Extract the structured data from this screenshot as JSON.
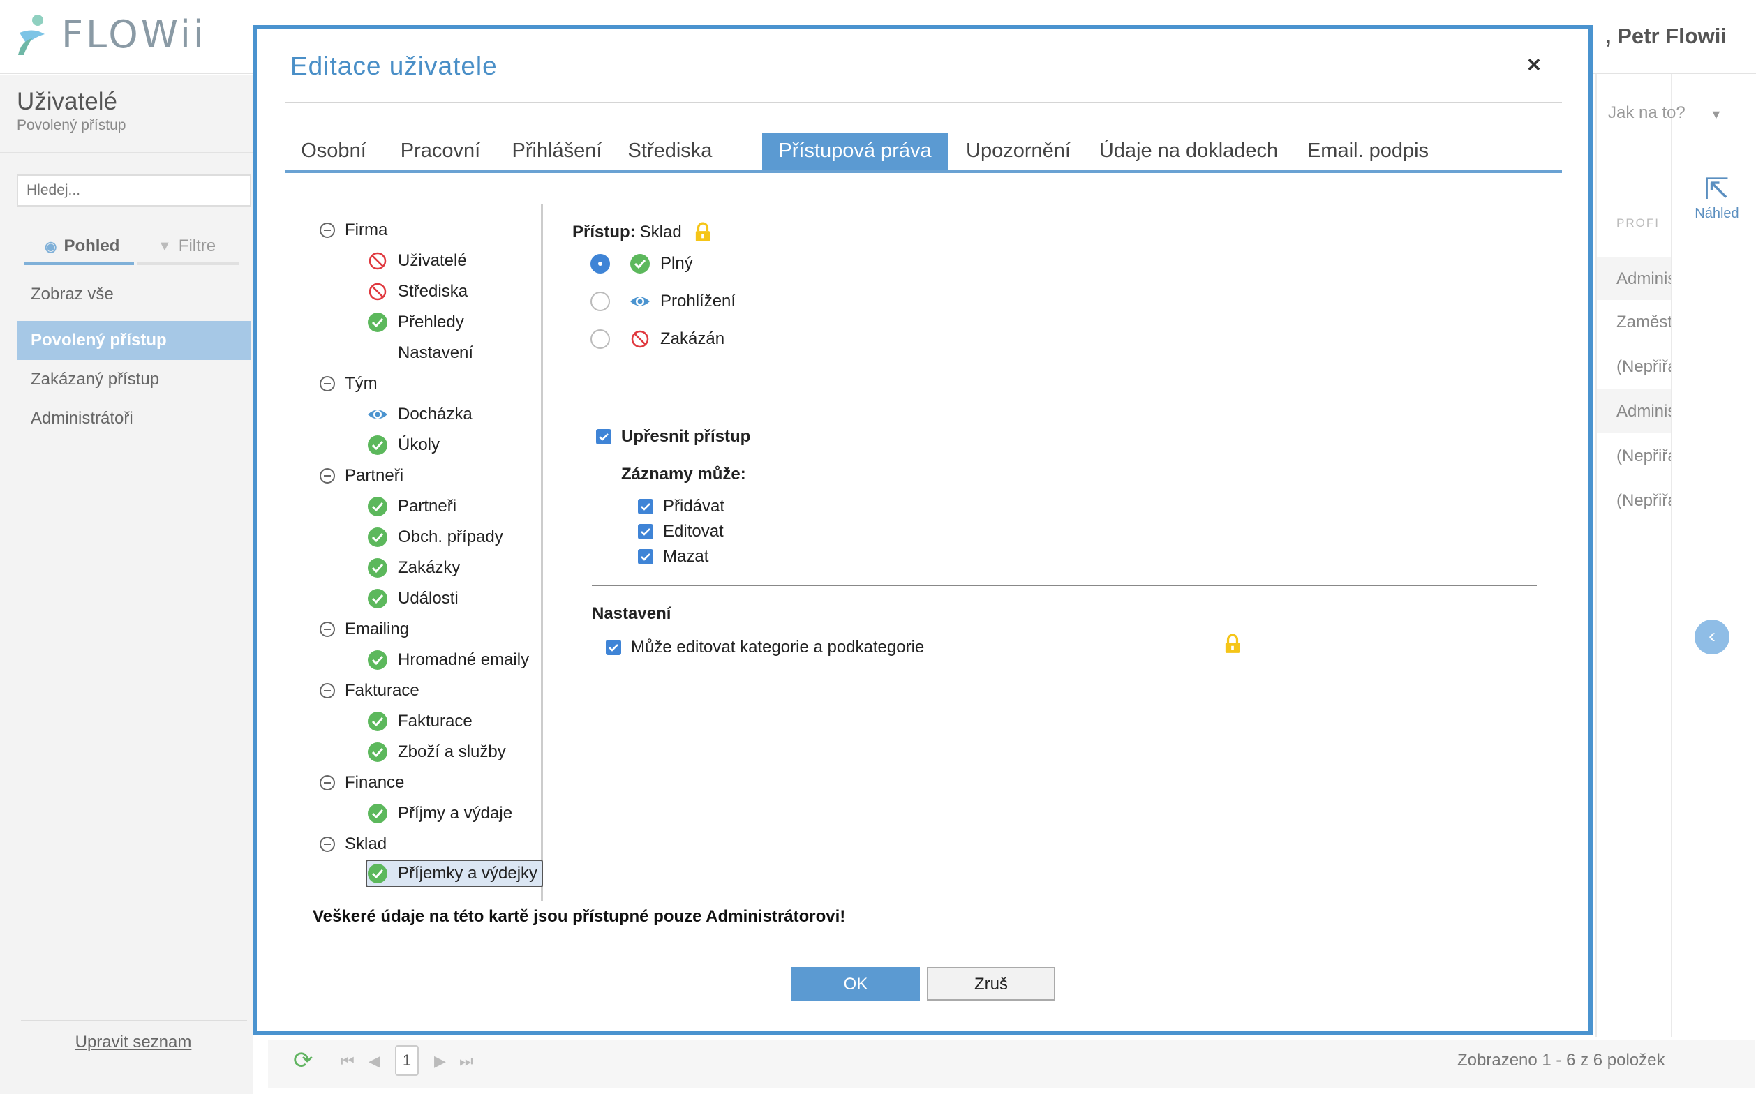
{
  "app": {
    "logo_text": "FLOWii",
    "user_name": ", Petr Flowii"
  },
  "sidebar": {
    "title": "Uživatelé",
    "subtitle": "Povolený přístup",
    "search_placeholder": "Hledej...",
    "tabs": [
      {
        "label": "Pohled"
      },
      {
        "label": "Filtre"
      }
    ],
    "items": [
      {
        "label": "Zobraz vše"
      },
      {
        "label": "Povolený přístup"
      },
      {
        "label": "Zakázaný přístup"
      },
      {
        "label": "Administrátoři"
      }
    ],
    "edit_list": "Upravit seznam"
  },
  "right": {
    "how_to": "Jak na to?",
    "column_header": "PROFI",
    "rows": [
      "Adminis",
      "Zaměst",
      "(Nepřiřa",
      "Adminis",
      "(Nepřiřa",
      "(Nepřiřa"
    ],
    "preview_label": "Náhled"
  },
  "pager": {
    "page": "1",
    "info": "Zobrazeno 1 - 6 z 6 položek"
  },
  "modal": {
    "title": "Editace uživatele",
    "close": "×",
    "tabs": [
      {
        "label": "Osobní"
      },
      {
        "label": "Pracovní"
      },
      {
        "label": "Přihlášení"
      },
      {
        "label": "Střediska"
      },
      {
        "label": "Přístupová práva"
      },
      {
        "label": "Upozornění"
      },
      {
        "label": "Údaje na dokladech"
      },
      {
        "label": "Email. podpis"
      }
    ],
    "active_tab": "Přístupová práva",
    "tree": [
      {
        "label": "Firma",
        "children": [
          {
            "label": "Uživatelé",
            "status": "denied"
          },
          {
            "label": "Střediska",
            "status": "denied"
          },
          {
            "label": "Přehledy",
            "status": "full"
          },
          {
            "label": "Nastavení",
            "status": "none"
          }
        ]
      },
      {
        "label": "Tým",
        "children": [
          {
            "label": "Docházka",
            "status": "view"
          },
          {
            "label": "Úkoly",
            "status": "full"
          }
        ]
      },
      {
        "label": "Partneři",
        "children": [
          {
            "label": "Partneři",
            "status": "full"
          },
          {
            "label": "Obch. případy",
            "status": "full"
          },
          {
            "label": "Zakázky",
            "status": "full"
          },
          {
            "label": "Události",
            "status": "full"
          }
        ]
      },
      {
        "label": "Emailing",
        "children": [
          {
            "label": "Hromadné emaily",
            "status": "full"
          }
        ]
      },
      {
        "label": "Fakturace",
        "children": [
          {
            "label": "Fakturace",
            "status": "full"
          },
          {
            "label": "Zboží a služby",
            "status": "full"
          }
        ]
      },
      {
        "label": "Finance",
        "children": [
          {
            "label": "Příjmy a výdaje",
            "status": "full"
          }
        ]
      },
      {
        "label": "Sklad",
        "children": [
          {
            "label": "Příjemky a výdejky",
            "status": "full",
            "selected": true
          }
        ]
      }
    ],
    "access": {
      "label": "Přístup:",
      "value": "Sklad",
      "options": [
        {
          "label": "Plný",
          "icon": "check-circle-icon",
          "selected": true
        },
        {
          "label": "Prohlížení",
          "icon": "eye-icon",
          "selected": false
        },
        {
          "label": "Zakázán",
          "icon": "forbidden-icon",
          "selected": false
        }
      ],
      "refine_label": "Upřesnit přístup",
      "records_label": "Záznamy může:",
      "permissions": [
        "Přidávat",
        "Editovat",
        "Mazat"
      ],
      "settings_label": "Nastavení",
      "settings_option": "Může editovat kategorie a podkategorie"
    },
    "footer_note": "Veškeré údaje na této kartě jsou přístupné pouze Administrátorovi!",
    "ok": "OK",
    "cancel": "Zruš"
  },
  "colors": {
    "accent": "#4a93cf",
    "status_full": "#5cb85c",
    "status_denied": "#e0383e",
    "status_view": "#4a93cf",
    "lock": "#f5c518"
  }
}
